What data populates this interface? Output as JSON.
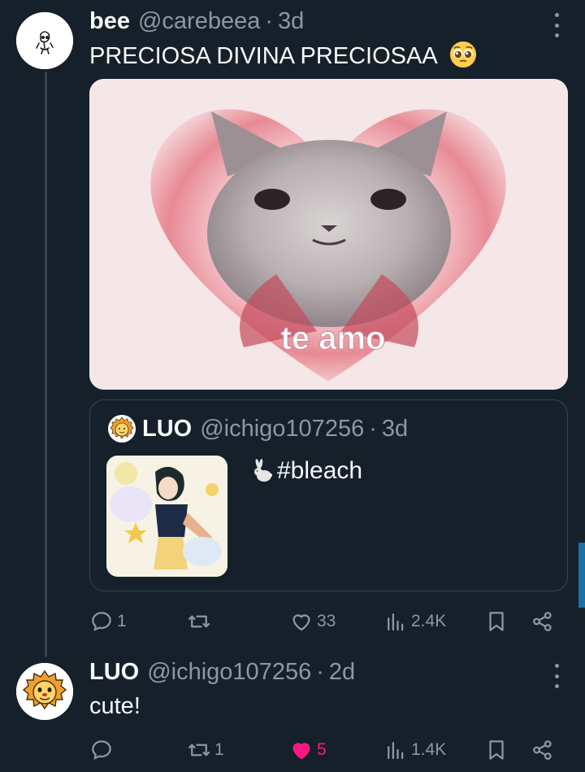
{
  "tweet1": {
    "name": "bee",
    "handle": "@carebeea",
    "separator": "·",
    "time": "3d",
    "text": "PRECIOSA DIVINA PRECIOSAA",
    "emoji": "pleading-face-emoji",
    "media_caption": "te amo",
    "quote": {
      "name": "LUO",
      "handle": "@ichigo107256",
      "separator": "·",
      "time": "3d",
      "text": "#bleach",
      "icon": "rabbit-icon"
    },
    "actions": {
      "replies": "1",
      "retweets": "",
      "likes": "33",
      "views": "2.4K"
    }
  },
  "tweet2": {
    "name": "LUO",
    "handle": "@ichigo107256",
    "separator": "·",
    "time": "2d",
    "text": "cute!",
    "actions": {
      "replies": "",
      "retweets": "1",
      "likes": "5",
      "views": "1.4K"
    },
    "liked": true
  },
  "colors": {
    "background": "#15202b",
    "secondary_text": "#8b98a5",
    "border": "#38444d",
    "like_pink": "#f91880"
  }
}
